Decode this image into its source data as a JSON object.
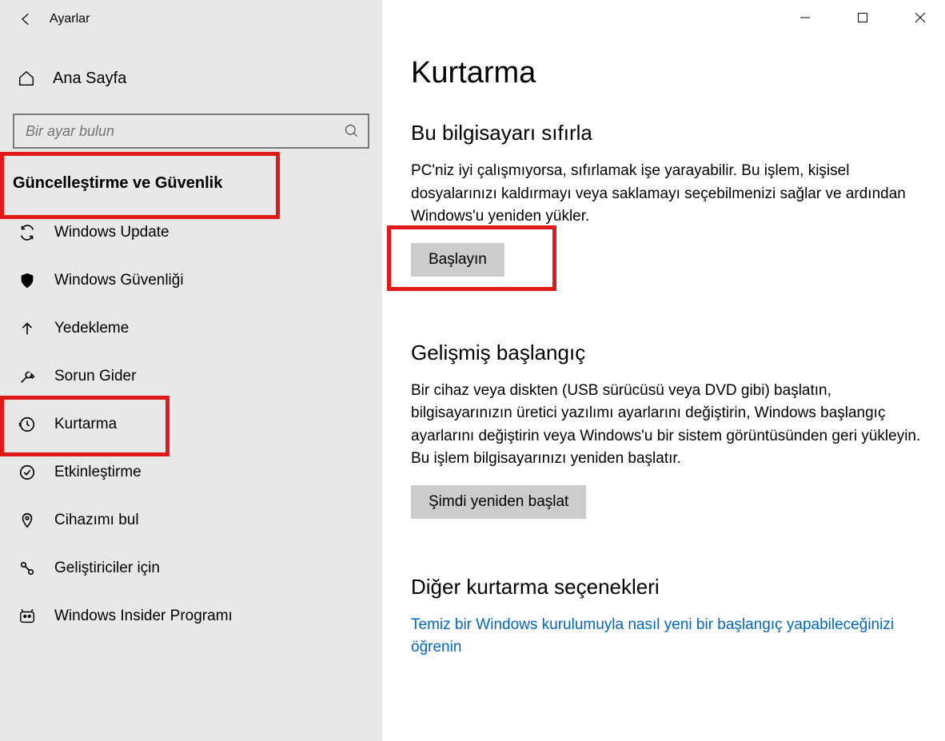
{
  "window": {
    "title": "Ayarlar"
  },
  "sidebar": {
    "home_label": "Ana Sayfa",
    "search_placeholder": "Bir ayar bulun",
    "section_header": "Güncelleştirme ve Güvenlik",
    "items": [
      {
        "id": "windows-update",
        "label": "Windows Update",
        "icon": "sync"
      },
      {
        "id": "windows-security",
        "label": "Windows Güvenliği",
        "icon": "shield"
      },
      {
        "id": "backup",
        "label": "Yedekleme",
        "icon": "uparrow"
      },
      {
        "id": "troubleshoot",
        "label": "Sorun Gider",
        "icon": "wrench"
      },
      {
        "id": "recovery",
        "label": "Kurtarma",
        "icon": "history"
      },
      {
        "id": "activation",
        "label": "Etkinleştirme",
        "icon": "checkcircle"
      },
      {
        "id": "find-device",
        "label": "Cihazımı bul",
        "icon": "location"
      },
      {
        "id": "developers",
        "label": "Geliştiriciler için",
        "icon": "devtools"
      },
      {
        "id": "insider",
        "label": "Windows Insider Programı",
        "icon": "insider"
      }
    ]
  },
  "main": {
    "title": "Kurtarma",
    "reset": {
      "heading": "Bu bilgisayarı sıfırla",
      "desc": "PC'niz iyi çalışmıyorsa, sıfırlamak işe yarayabilir. Bu işlem, kişisel dosyalarınızı kaldırmayı veya saklamayı seçebilmenizi sağlar ve ardından Windows'u yeniden yükler.",
      "button": "Başlayın"
    },
    "advanced": {
      "heading": "Gelişmiş başlangıç",
      "desc": "Bir cihaz veya diskten (USB sürücüsü veya DVD gibi) başlatın, bilgisayarınızın üretici yazılımı ayarlarını değiştirin, Windows başlangıç ayarlarını değiştirin veya Windows'u bir sistem görüntüsünden geri yükleyin. Bu işlem bilgisayarınızı yeniden başlatır.",
      "button": "Şimdi yeniden başlat"
    },
    "more": {
      "heading": "Diğer kurtarma seçenekleri",
      "link": "Temiz bir Windows kurulumuyla nasıl yeni bir başlangıç yapabileceğinizi öğrenin"
    }
  }
}
